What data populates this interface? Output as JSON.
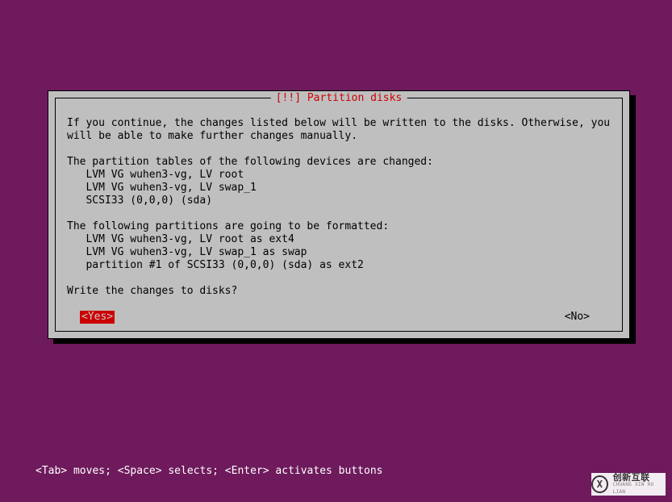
{
  "dialog": {
    "title": "[!!] Partition disks",
    "body": "If you continue, the changes listed below will be written to the disks. Otherwise, you\nwill be able to make further changes manually.\n\nThe partition tables of the following devices are changed:\n   LVM VG wuhen3-vg, LV root\n   LVM VG wuhen3-vg, LV swap_1\n   SCSI33 (0,0,0) (sda)\n\nThe following partitions are going to be formatted:\n   LVM VG wuhen3-vg, LV root as ext4\n   LVM VG wuhen3-vg, LV swap_1 as swap\n   partition #1 of SCSI33 (0,0,0) (sda) as ext2\n\nWrite the changes to disks?",
    "yes_label": "<Yes>",
    "no_label": "<No>"
  },
  "hint": "<Tab> moves; <Space> selects; <Enter> activates buttons",
  "watermark": {
    "logo_letter": "X",
    "line1": "创新互联",
    "line2": "CHUANG XIN HU LIAN"
  },
  "colors": {
    "background": "#6e1a5c",
    "panel": "#bfbfbf",
    "accent": "#cc0000"
  }
}
